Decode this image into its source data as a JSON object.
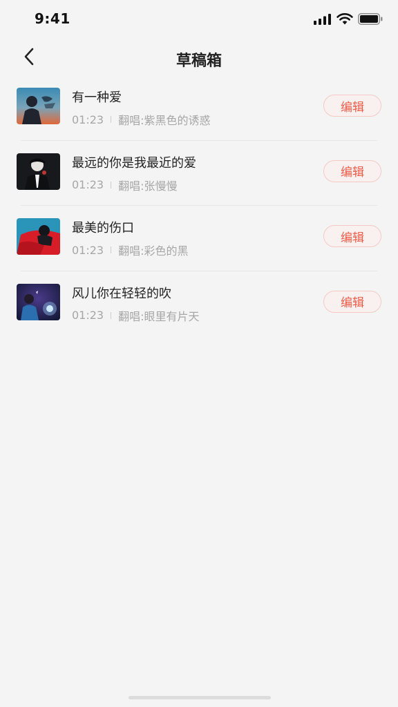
{
  "status_bar": {
    "time": "9:41"
  },
  "header": {
    "title": "草稿箱"
  },
  "drafts": [
    {
      "title": "有一种爱",
      "duration": "01:23",
      "cover_label": "翻唱:紫黑色的诱惑",
      "edit_label": "编辑"
    },
    {
      "title": "最远的你是我最近的爱",
      "duration": "01:23",
      "cover_label": "翻唱:张慢慢",
      "edit_label": "编辑"
    },
    {
      "title": "最美的伤口",
      "duration": "01:23",
      "cover_label": "翻唱:彩色的黑",
      "edit_label": "编辑"
    },
    {
      "title": "风儿你在轻轻的吹",
      "duration": "01:23",
      "cover_label": "翻唱:眼里有片天",
      "edit_label": "编辑"
    }
  ],
  "colors": {
    "accent": "#f25a46",
    "background": "#f4f4f4",
    "secondary_text": "#a6a6a6"
  }
}
